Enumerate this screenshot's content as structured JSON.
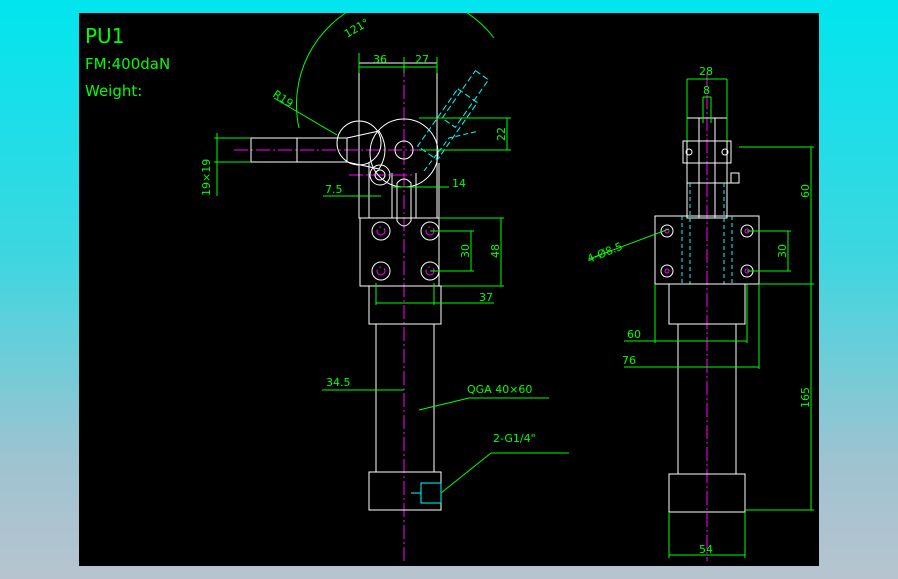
{
  "title_block": {
    "model": "PU1",
    "force": "FM:400daN",
    "weight": "Weight:"
  },
  "dimensions": {
    "angle": "121°",
    "d36": "36",
    "d27": "27",
    "r19": "R19",
    "d22": "22",
    "handle": "19×19",
    "d7_5": "7.5",
    "d14": "14",
    "d30_left": "30",
    "d48": "48",
    "d37": "37",
    "d34_5": "34.5",
    "cylinder": "QGA 40×60",
    "port": "2-G1/4\"",
    "d28": "28",
    "d8": "8",
    "holes": "4-Ø8.5",
    "d60_right": "60",
    "d30_right": "30",
    "d60_low": "60",
    "d76": "76",
    "d165": "165",
    "d54": "54"
  }
}
